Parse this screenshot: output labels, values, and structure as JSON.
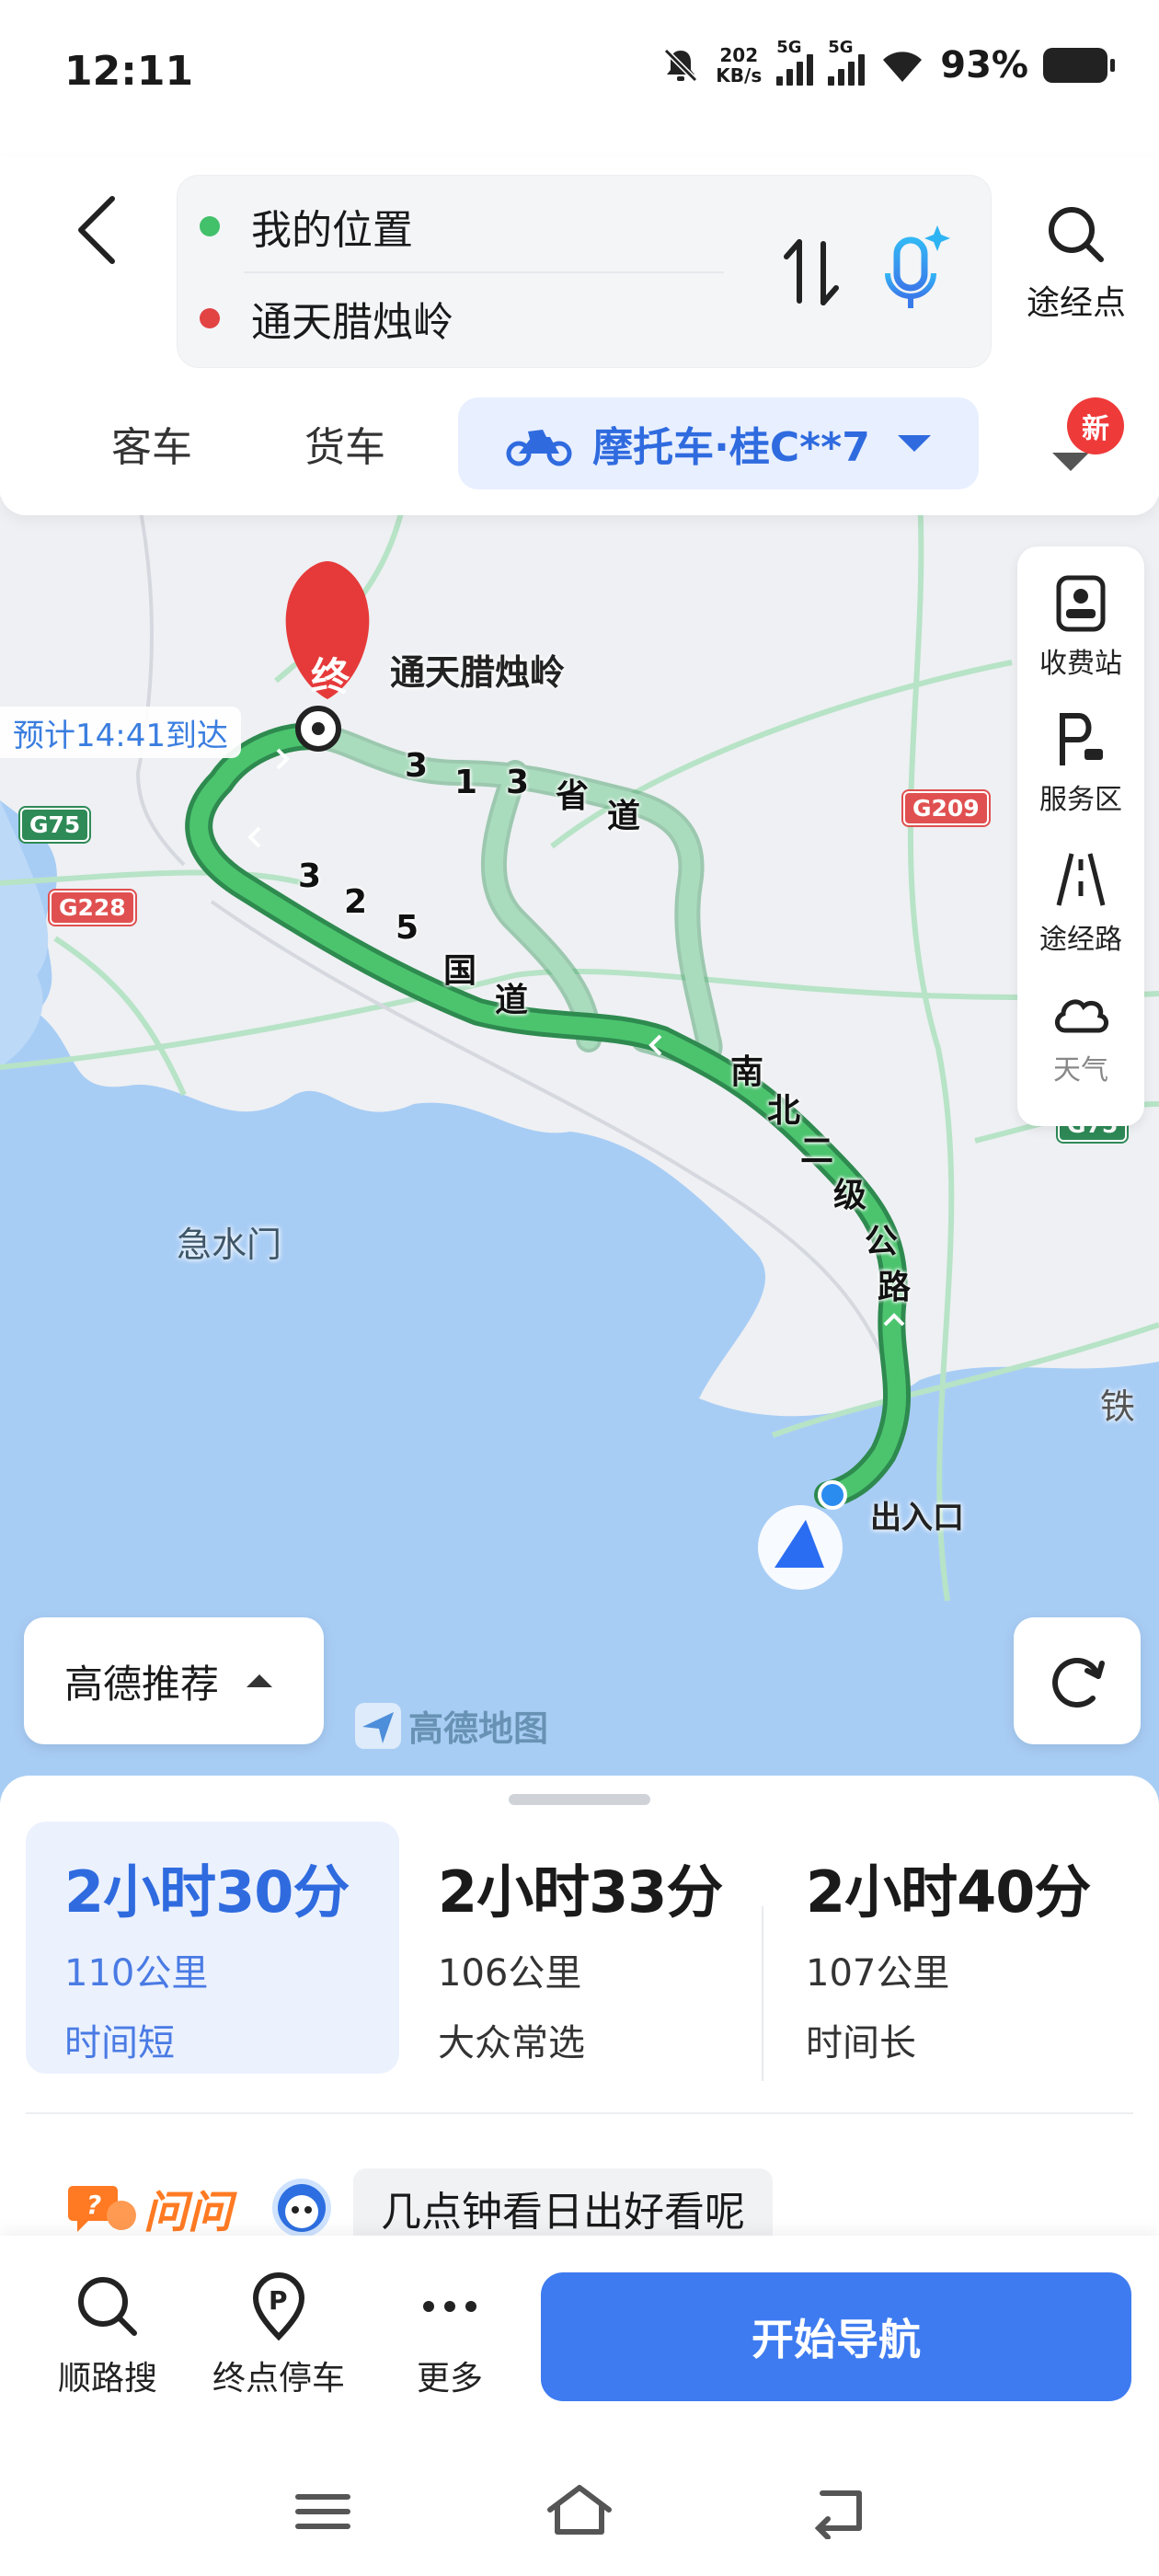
{
  "status_bar": {
    "time": "12:11",
    "net_speed_value": "202",
    "net_speed_unit": "KB/s",
    "sim1_label": "5G",
    "sim2_label": "5G",
    "battery": "93%"
  },
  "route": {
    "origin": "我的位置",
    "destination": "通天腊烛岭",
    "via_label": "途经点"
  },
  "vehicle_tabs": {
    "bus": "客车",
    "truck": "货车",
    "moto": "摩托车·桂C**7",
    "new_badge": "新"
  },
  "map": {
    "destination_marker": "终",
    "destination_label": "通天腊烛岭",
    "eta": "预计14:41到达",
    "shields": [
      "G75",
      "G228",
      "G209",
      "G75"
    ],
    "road_s313": [
      "3",
      "1",
      "3",
      "省",
      "道"
    ],
    "road_g325": [
      "3",
      "2",
      "5",
      "国",
      "道"
    ],
    "road_nanbei": [
      "南",
      "北",
      "二",
      "级",
      "公",
      "路"
    ],
    "place_jishuimen": "急水门",
    "place_tie": "铁",
    "entrance_label": "出入口",
    "logo_text": "高德地图",
    "tools": {
      "toll": "收费站",
      "service": "服务区",
      "road": "途经路",
      "weather": "天气"
    },
    "recommend_label": "高德推荐",
    "colors": {
      "route": "#3fba62",
      "route_alt": "#a9dcbd",
      "sea": "#a8cdf5",
      "land": "#eef0f3"
    }
  },
  "routes": [
    {
      "duration": "2小时30分",
      "distance": "110公里",
      "tag": "时间短"
    },
    {
      "duration": "2小时33分",
      "distance": "106公里",
      "tag": "大众常选"
    },
    {
      "duration": "2小时40分",
      "distance": "107公里",
      "tag": "时间长"
    }
  ],
  "ask": {
    "brand": "问问",
    "question": "几点钟看日出好看呢"
  },
  "bottom": {
    "along_search": "顺路搜",
    "dest_parking": "终点停车",
    "more": "更多",
    "start_nav": "开始导航"
  },
  "accent_color": "#3e7bf0"
}
